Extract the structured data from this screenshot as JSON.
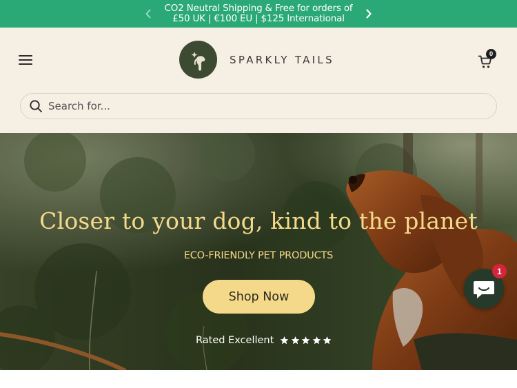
{
  "announcement": {
    "text": "CO2 Neutral Shipping & Free for orders of £50 UK | €100 EU | $125 International",
    "prev_icon": "chevron-left-icon",
    "next_icon": "chevron-right-icon"
  },
  "header": {
    "menu_icon": "hamburger-menu-icon",
    "logo_text": "SPARKLY TAILS",
    "cart_icon": "shopping-cart-icon",
    "cart_count": "0"
  },
  "search": {
    "placeholder": "Search for...",
    "value": "",
    "icon": "search-icon"
  },
  "hero": {
    "title": "Closer to your dog, kind to the planet",
    "subtitle": "ECO-FRIENDLY PET PRODUCTS",
    "cta_label": "Shop Now",
    "rating_label": "Rated Excellent",
    "stars": 5
  },
  "chat": {
    "icon": "chat-bubble-icon",
    "badge_count": "1"
  },
  "colors": {
    "announcement_bg": "#2aa876",
    "header_bg": "#f6efe4",
    "accent_gold": "#f5d98a",
    "logo_green": "#3b4a31",
    "chat_bg": "#263a2b",
    "badge_red": "#d5243b"
  }
}
